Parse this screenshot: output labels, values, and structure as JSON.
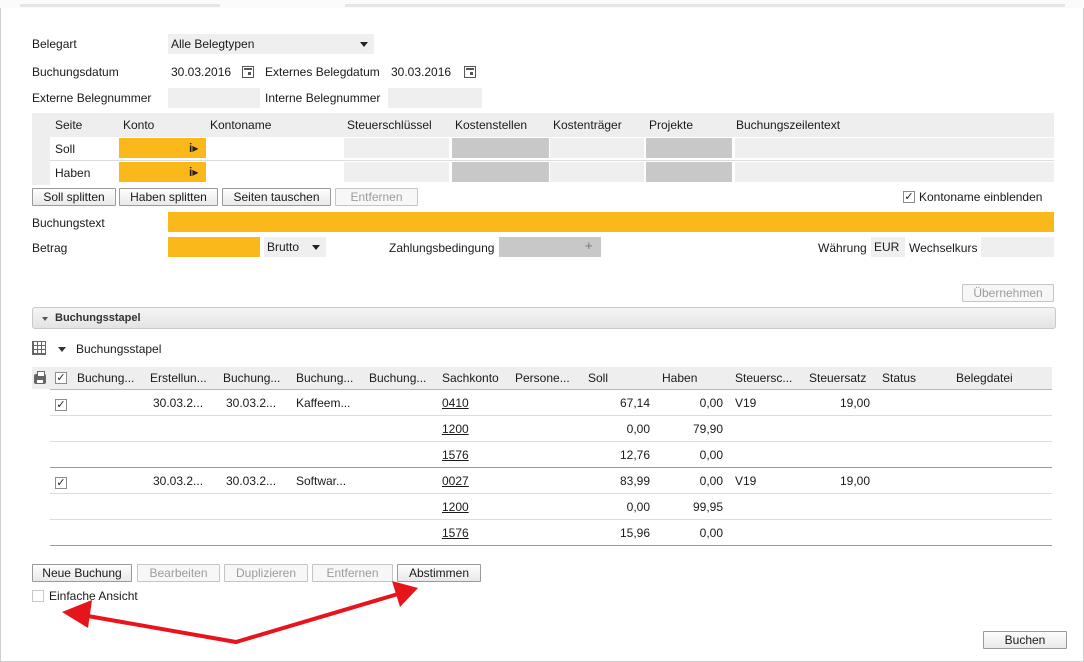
{
  "form": {
    "belegart_label": "Belegart",
    "belegart_value": "Alle Belegtypen",
    "buchungsdatum_label": "Buchungsdatum",
    "buchungsdatum_value": "30.03.2016",
    "ext_belegdatum_label": "Externes Belegdatum",
    "ext_belegdatum_value": "30.03.2016",
    "ext_belegnummer_label": "Externe Belegnummer",
    "ext_belegnummer_value": "",
    "int_belegnummer_label": "Interne Belegnummer",
    "int_belegnummer_value": ""
  },
  "entry_table": {
    "headers": [
      "Seite",
      "Konto",
      "Kontoname",
      "Steuerschlüssel",
      "Kostenstellen",
      "Kostenträger",
      "Projekte",
      "Buchungszeilentext"
    ],
    "rows": [
      "Soll",
      "Haben"
    ]
  },
  "entry_buttons": {
    "soll_splitten": "Soll splitten",
    "haben_splitten": "Haben splitten",
    "seiten_tauschen": "Seiten tauschen",
    "entfernen": "Entfernen",
    "kontoname_einblenden": "Kontoname einblenden",
    "kontoname_checked": "✓"
  },
  "booking": {
    "buchungstext_label": "Buchungstext",
    "betrag_label": "Betrag",
    "brutto_value": "Brutto",
    "zahlungsbedingung_label": "Zahlungsbedingung",
    "waehrung_label": "Währung",
    "waehrung_value": "EUR",
    "wechselkurs_label": "Wechselkurs",
    "uebernehmen": "Übernehmen"
  },
  "stapel": {
    "section_title": "Buchungsstapel",
    "dropdown_label": "Buchungsstapel",
    "header_check": "✓",
    "headers": [
      "Buchung...",
      "Erstellun...",
      "Buchung...",
      "Buchung...",
      "Buchung...",
      "Sachkonto",
      "Persone...",
      "Soll",
      "Haben",
      "Steuersc...",
      "Steuersatz",
      "Status",
      "Belegdatei"
    ],
    "groups": [
      {
        "check": "✓",
        "erstellung": "30.03.2...",
        "buchungsdatum": "30.03.2...",
        "text": "Kaffeem...",
        "lines": [
          {
            "sachkonto": "0410",
            "soll": "67,14",
            "haben": "0,00",
            "steuer": "V19",
            "satz": "19,00"
          },
          {
            "sachkonto": "1200",
            "soll": "0,00",
            "haben": "79,90",
            "steuer": "",
            "satz": ""
          },
          {
            "sachkonto": "1576",
            "soll": "12,76",
            "haben": "0,00",
            "steuer": "",
            "satz": ""
          }
        ]
      },
      {
        "check": "✓",
        "erstellung": "30.03.2...",
        "buchungsdatum": "30.03.2...",
        "text": "Softwar...",
        "lines": [
          {
            "sachkonto": "0027",
            "soll": "83,99",
            "haben": "0,00",
            "steuer": "V19",
            "satz": "19,00"
          },
          {
            "sachkonto": "1200",
            "soll": "0,00",
            "haben": "99,95",
            "steuer": "",
            "satz": ""
          },
          {
            "sachkonto": "1576",
            "soll": "15,96",
            "haben": "0,00",
            "steuer": "",
            "satz": ""
          }
        ]
      }
    ]
  },
  "bottom": {
    "neue_buchung": "Neue Buchung",
    "bearbeiten": "Bearbeiten",
    "duplizieren": "Duplizieren",
    "entfernen": "Entfernen",
    "abstimmen": "Abstimmen",
    "einfache_ansicht": "Einfache Ansicht",
    "buchen": "Buchen"
  },
  "colors": {
    "required_field": "#fbb81b",
    "annotation_arrow": "#e8141b"
  }
}
